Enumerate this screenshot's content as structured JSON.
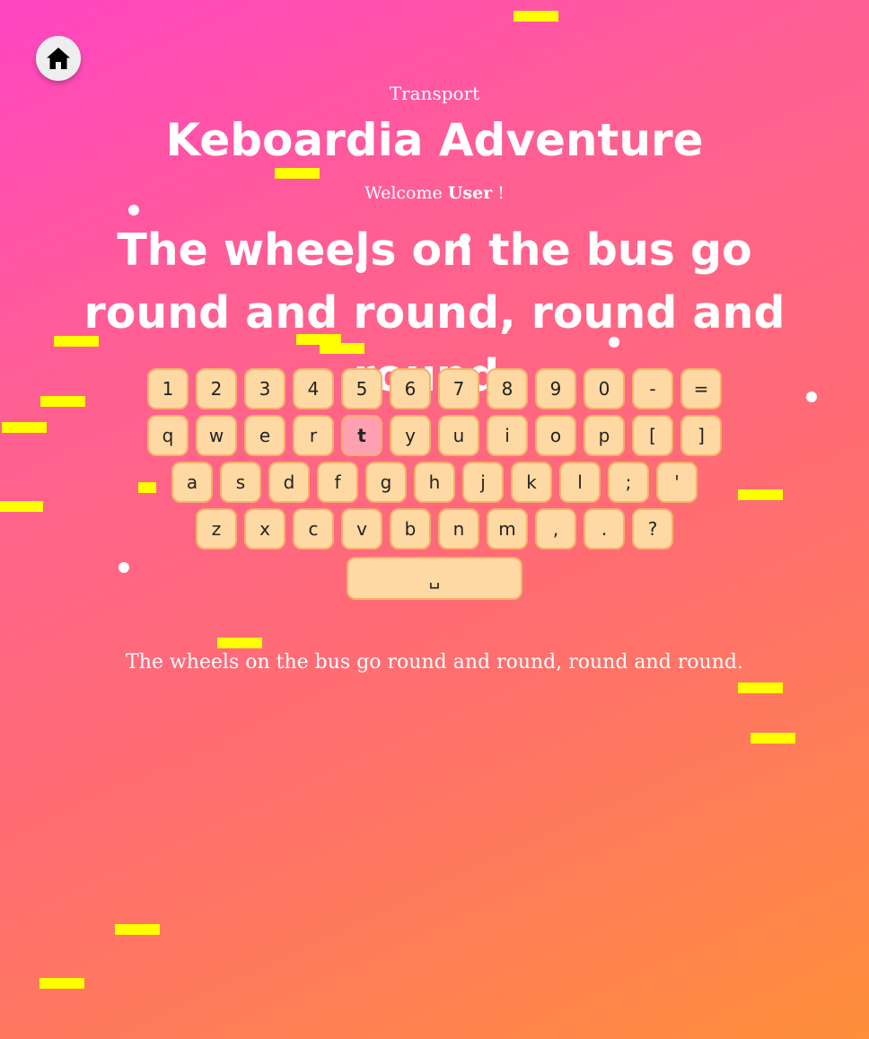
{
  "nav": {
    "home_icon": "home-icon"
  },
  "header": {
    "category": "Transport",
    "title": "Keboardia Adventure",
    "welcome_prefix": "Welcome",
    "user": "User",
    "welcome_suffix": "!"
  },
  "prompt": {
    "sentence": "The wheels on the bus go round and round, round and round."
  },
  "keyboard": {
    "active_key": "t",
    "rows": [
      [
        "1",
        "2",
        "3",
        "4",
        "5",
        "6",
        "7",
        "8",
        "9",
        "0",
        "-",
        "="
      ],
      [
        "q",
        "w",
        "e",
        "r",
        "t",
        "y",
        "u",
        "i",
        "o",
        "p",
        "[",
        "]"
      ],
      [
        "a",
        "s",
        "d",
        "f",
        "g",
        "h",
        "j",
        "k",
        "l",
        ";",
        "'"
      ],
      [
        "z",
        "x",
        "c",
        "v",
        "b",
        "n",
        "m",
        ",",
        ".",
        "?"
      ]
    ],
    "space_label": "␣"
  },
  "typed": {
    "text": "The wheels on the bus go round and round, round and round."
  },
  "colors": {
    "gradient_start": "#ff45c2",
    "gradient_end": "#ff8f3a",
    "key_fill": "#ffd9a3",
    "key_border": "#f5b06a",
    "key_active": "#ff9fb2",
    "confetti": "#ffff00"
  }
}
